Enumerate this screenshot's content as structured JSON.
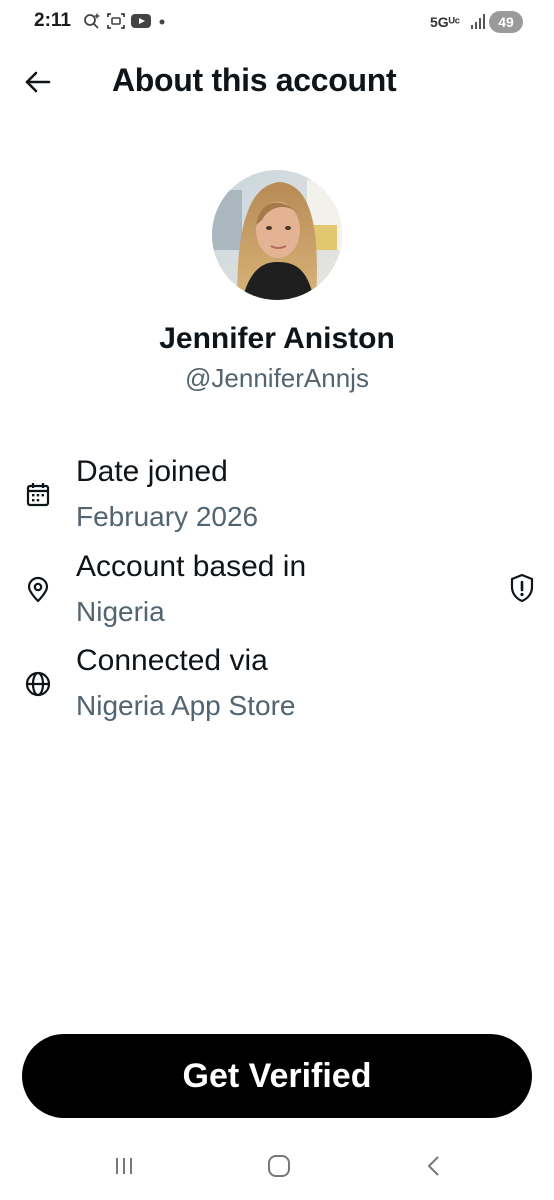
{
  "status_bar": {
    "time": "2:11",
    "network": "5Gᵁᶜ",
    "battery": "49",
    "icons": [
      "assistant-icon",
      "screen-capture-icon",
      "youtube-icon",
      "notification-dot-icon",
      "signal-icon"
    ]
  },
  "header": {
    "back_icon": "back-arrow-icon",
    "title": "About this account"
  },
  "profile": {
    "name": "Jennifer Aniston",
    "handle": "@JenniferAnnjs"
  },
  "details": [
    {
      "icon": "calendar-icon",
      "label": "Date joined",
      "value": "February 2026"
    },
    {
      "icon": "location-pin-icon",
      "label": "Account based in",
      "value": "Nigeria"
    },
    {
      "icon": "globe-icon",
      "label": "Connected via",
      "value": "Nigeria App Store"
    }
  ],
  "shield_icon": "shield-alert-icon",
  "cta": {
    "label": "Get Verified"
  },
  "nav_bar": {
    "icons": [
      "recent-apps-icon",
      "home-icon",
      "back-icon"
    ]
  },
  "colors": {
    "text_primary": "#0f1419",
    "text_secondary": "#536471",
    "button_bg": "#000000",
    "button_text": "#ffffff"
  }
}
